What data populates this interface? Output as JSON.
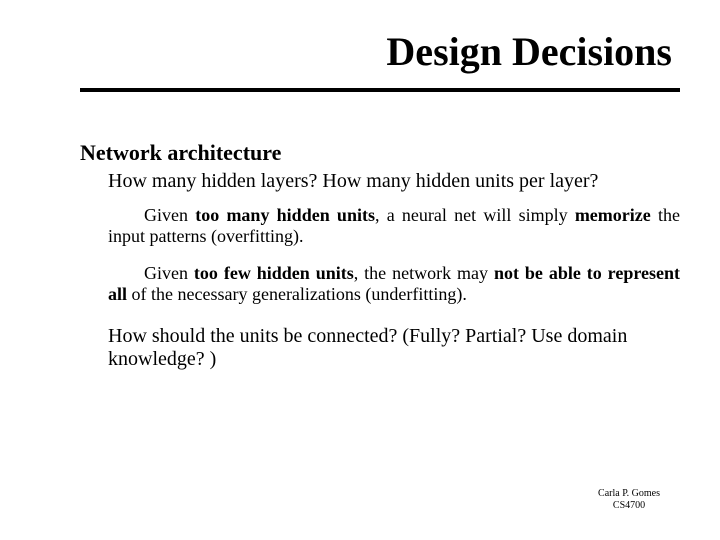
{
  "title": "Design Decisions",
  "heading": "Network architecture",
  "question1": "How many hidden layers? How many hidden units per layer?",
  "p1_a": "Given ",
  "p1_b": "too many hidden units",
  "p1_c": ", a neural net will simply ",
  "p1_d": "memorize",
  "p1_e": " the input patterns (overfitting).",
  "p2_a": "Given ",
  "p2_b": "too few hidden units",
  "p2_c": ", the network may ",
  "p2_d": "not be able to represent all",
  "p2_e": " of the necessary generalizations (underfitting).",
  "question2": "How should the units be connected? (Fully? Partial? Use domain knowledge? )",
  "footer_name": "Carla P. Gomes",
  "footer_course": "CS4700"
}
